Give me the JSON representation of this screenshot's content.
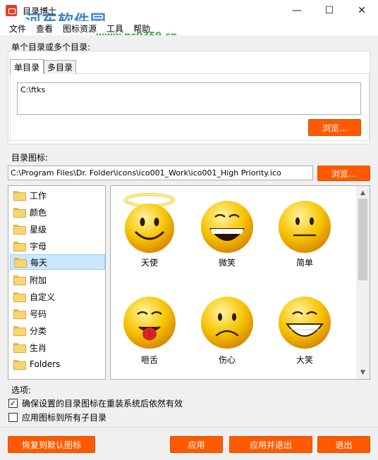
{
  "window": {
    "title": "目录博士",
    "watermark": "河东软件园",
    "watermark_url": "www.pc0359.cn",
    "minimize_glyph": "—",
    "maximize_glyph": "☐",
    "close_glyph": "✕"
  },
  "menu": [
    "文件",
    "查看",
    "图标资源",
    "工具",
    "帮助"
  ],
  "directory_section": {
    "label": "单个目录或多个目录:",
    "tabs": [
      "单目录",
      "多目录"
    ],
    "active_tab": "单目录",
    "value": "C:\\ftks",
    "browse_label": "浏览..."
  },
  "icon_section": {
    "label": "目录图标:",
    "path": "C:\\Program Files\\Dr. Folder\\icons\\ico001_Work\\ico001_High Priority.ico",
    "browse_label": "浏览..."
  },
  "tree": {
    "items": [
      "工作",
      "颜色",
      "星级",
      "字母",
      "每天",
      "附加",
      "自定义",
      "号码",
      "分类",
      "生肖",
      "Folders"
    ],
    "selected": "每天"
  },
  "icons": [
    {
      "label": "天使",
      "icon": "angel-smiley-icon"
    },
    {
      "label": "微笑",
      "icon": "big-grin-smiley-icon"
    },
    {
      "label": "简单",
      "icon": "neutral-smiley-icon"
    },
    {
      "label": "咂舌",
      "icon": "tongue-smiley-icon"
    },
    {
      "label": "伤心",
      "icon": "sad-smiley-icon"
    },
    {
      "label": "大笑",
      "icon": "laugh-smiley-icon"
    }
  ],
  "options": {
    "label": "选项:",
    "keep_after_reinstall": {
      "label": "确保设置的目录图标在重装系统后依然有效",
      "checked": true
    },
    "apply_to_subfolders": {
      "label": "应用图标到所有子目录",
      "checked": false
    }
  },
  "buttons": {
    "restore_default": "恢复到默认图标",
    "apply": "应用",
    "apply_and_exit": "应用并退出",
    "exit": "退出"
  },
  "colors": {
    "accent": "#ff5a00",
    "selection": "#cce8ff",
    "smiley_yellow": "#f7b800"
  }
}
